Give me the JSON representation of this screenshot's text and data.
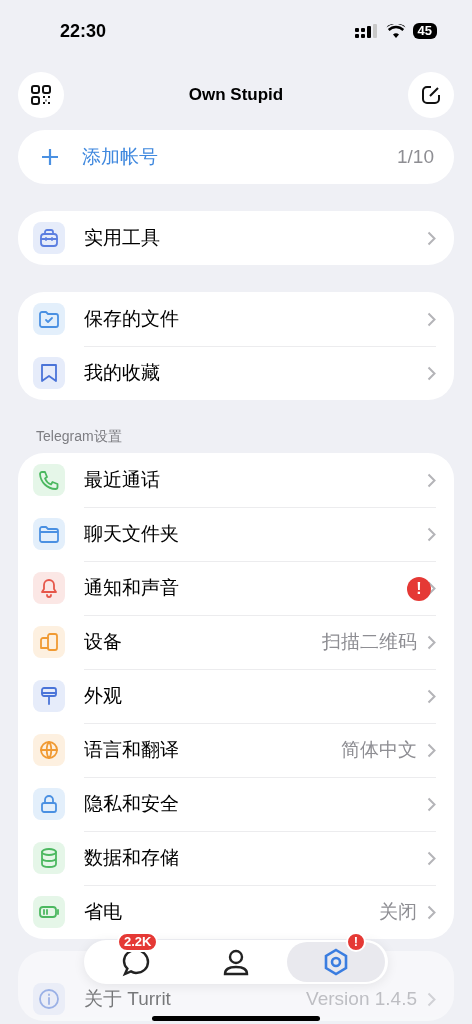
{
  "status_bar": {
    "time": "22:30",
    "battery": "45"
  },
  "header": {
    "title": "Own Stupid"
  },
  "add_account": {
    "label": "添加帐号",
    "count": "1/10"
  },
  "groups": [
    {
      "items": [
        {
          "kind": "toolbox",
          "label": "实用工具"
        }
      ]
    },
    {
      "items": [
        {
          "kind": "folder-check",
          "label": "保存的文件"
        },
        {
          "kind": "bookmark",
          "label": "我的收藏"
        }
      ]
    },
    {
      "header": "Telegram设置",
      "items": [
        {
          "kind": "phone",
          "label": "最近通话"
        },
        {
          "kind": "folder",
          "label": "聊天文件夹"
        },
        {
          "kind": "bell",
          "label": "通知和声音",
          "badge": "!"
        },
        {
          "kind": "devices",
          "label": "设备",
          "value": "扫描二维码"
        },
        {
          "kind": "brush",
          "label": "外观"
        },
        {
          "kind": "globe",
          "label": "语言和翻译",
          "value": "简体中文"
        },
        {
          "kind": "lock",
          "label": "隐私和安全"
        },
        {
          "kind": "database",
          "label": "数据和存储"
        },
        {
          "kind": "battery",
          "label": "省电",
          "value": "关闭"
        }
      ]
    },
    {
      "dimmed": true,
      "items": [
        {
          "kind": "info",
          "label": "关于 Turrit",
          "value": "Version 1.4.5"
        }
      ]
    }
  ],
  "tab_bar": [
    {
      "kind": "chat",
      "badge": "2.2K",
      "selected": false
    },
    {
      "kind": "person",
      "selected": false
    },
    {
      "kind": "settings",
      "badge": "!",
      "selected": true
    }
  ]
}
